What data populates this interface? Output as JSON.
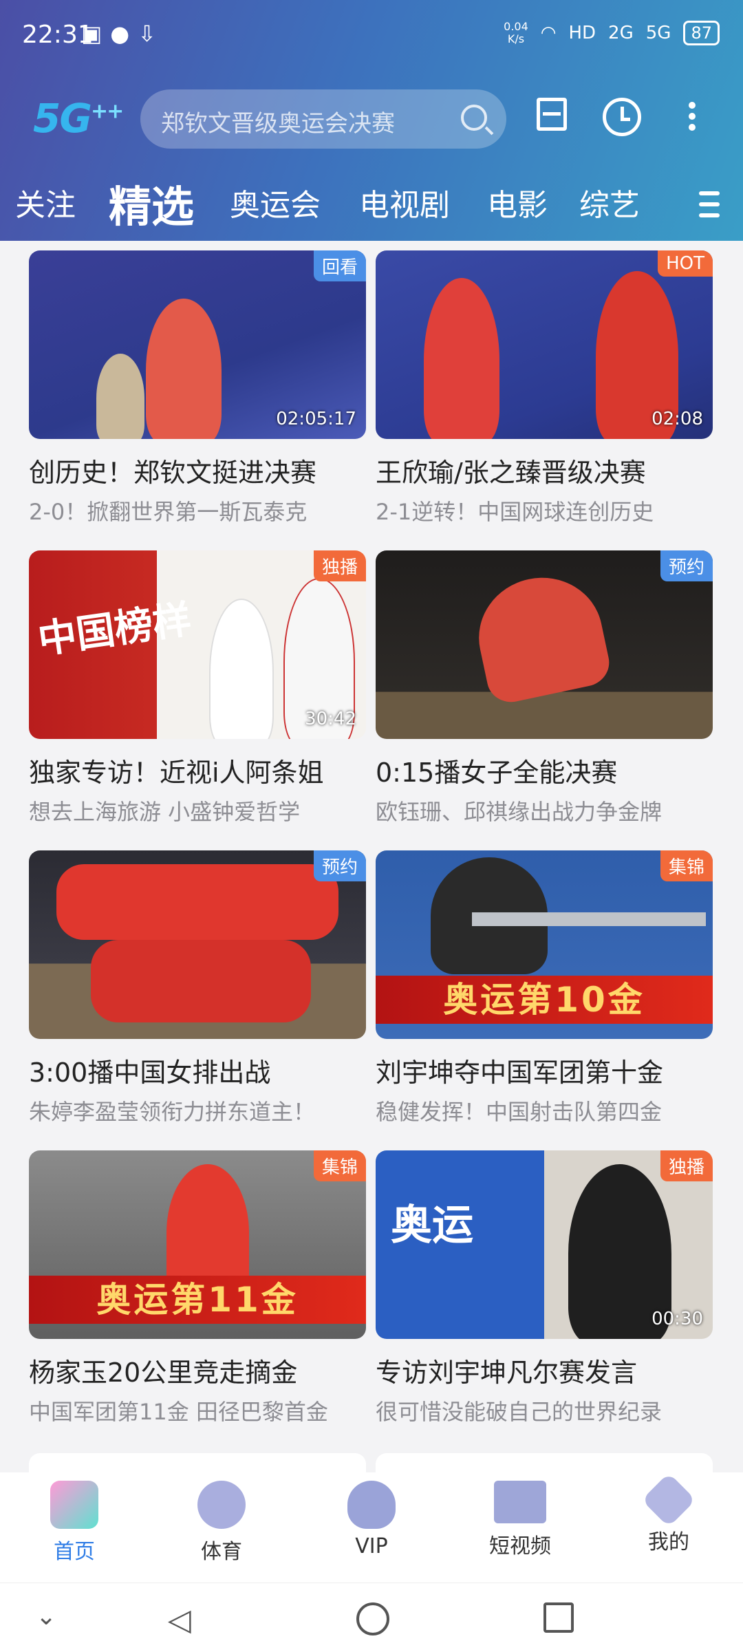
{
  "status_bar": {
    "time": "22:31",
    "net_speed_top": "0.04",
    "net_speed_bottom": "K/s",
    "signal_labels": [
      "HD",
      "2G",
      "5G"
    ],
    "battery": "87"
  },
  "topbar": {
    "logo": "5G",
    "logo_sup": "++",
    "search_placeholder": "郑钦文晋级奥运会决赛"
  },
  "tabs": [
    {
      "label": "关注",
      "active": false
    },
    {
      "label": "精选",
      "active": true
    },
    {
      "label": "奥运会",
      "active": false
    },
    {
      "label": "电视剧",
      "active": false
    },
    {
      "label": "电影",
      "active": false
    },
    {
      "label": "综艺",
      "active": false
    }
  ],
  "cards": [
    {
      "tag": "回看",
      "tag_color": "blue",
      "duration": "02:05:17",
      "title": "创历史！郑钦文挺进决赛",
      "subtitle": "2-0！掀翻世界第一斯瓦泰克"
    },
    {
      "tag": "HOT",
      "tag_color": "orange",
      "duration": "02:08",
      "title": "王欣瑜/张之臻晋级决赛",
      "subtitle": "2-1逆转！中国网球连创历史"
    },
    {
      "tag": "独播",
      "tag_color": "orange",
      "duration": "30:42",
      "title": "独家专访！近视i人阿条姐",
      "subtitle": "想去上海旅游 小盛钟爱哲学",
      "overlay": "中国榜样"
    },
    {
      "tag": "预约",
      "tag_color": "blue",
      "duration": "",
      "title": "0:15播女子全能决赛",
      "subtitle": "欧钰珊、邱祺缘出战力争金牌"
    },
    {
      "tag": "预约",
      "tag_color": "blue",
      "duration": "",
      "title": "3:00播中国女排出战",
      "subtitle": "朱婷李盈莹领衔力拼东道主！"
    },
    {
      "tag": "集锦",
      "tag_color": "orange",
      "duration": "",
      "title": "刘宇坤夺中国军团第十金",
      "subtitle": "稳健发挥！中国射击队第四金",
      "overlay": "奥运第10金"
    },
    {
      "tag": "集锦",
      "tag_color": "orange",
      "duration": "",
      "title": "杨家玉20公里竞走摘金",
      "subtitle": "中国军团第11金 田径巴黎首金",
      "overlay": "奥运第11金"
    },
    {
      "tag": "独播",
      "tag_color": "orange",
      "duration": "00:30",
      "title": "专访刘宇坤凡尔赛发言",
      "subtitle": "很可惜没能破自己的世界纪录",
      "overlay": "奥运"
    }
  ],
  "bottom_nav": [
    {
      "label": "首页",
      "icon": "home-icon",
      "active": true
    },
    {
      "label": "体育",
      "icon": "sports-icon",
      "active": false
    },
    {
      "label": "VIP",
      "icon": "vip-flame-icon",
      "active": false
    },
    {
      "label": "短视频",
      "icon": "short-video-icon",
      "active": false
    },
    {
      "label": "我的",
      "icon": "heart-profile-icon",
      "active": false
    }
  ]
}
